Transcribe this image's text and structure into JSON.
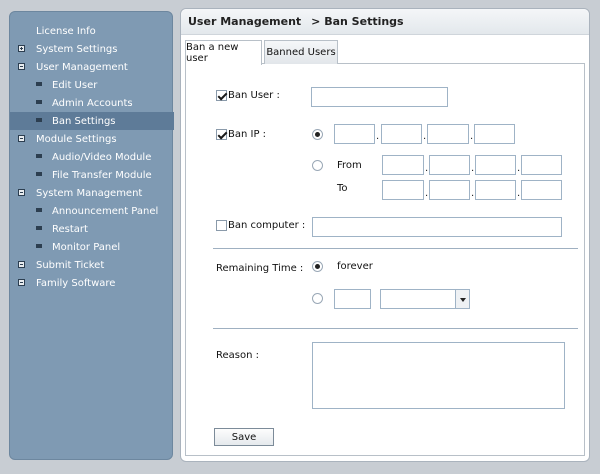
{
  "sidebar": {
    "items": [
      {
        "label": "License Info",
        "level": 0,
        "icon": "none"
      },
      {
        "label": "System Settings",
        "level": 0,
        "icon": "expand-plus-icon"
      },
      {
        "label": "User Management",
        "level": 0,
        "icon": "collapse-minus-icon"
      },
      {
        "label": "Edit User",
        "level": 1,
        "icon": "item-bullet-icon"
      },
      {
        "label": "Admin Accounts",
        "level": 1,
        "icon": "item-bullet-icon"
      },
      {
        "label": "Ban Settings",
        "level": 1,
        "icon": "item-bullet-icon",
        "selected": true
      },
      {
        "label": "Module Settings",
        "level": 0,
        "icon": "collapse-minus-icon"
      },
      {
        "label": "Audio/Video Module",
        "level": 1,
        "icon": "item-bullet-icon"
      },
      {
        "label": "File Transfer Module",
        "level": 1,
        "icon": "item-bullet-icon"
      },
      {
        "label": "System Management",
        "level": 0,
        "icon": "collapse-minus-icon"
      },
      {
        "label": "Announcement Panel",
        "level": 1,
        "icon": "item-bullet-icon"
      },
      {
        "label": "Restart",
        "level": 1,
        "icon": "item-bullet-icon"
      },
      {
        "label": "Monitor Panel",
        "level": 1,
        "icon": "item-bullet-icon"
      },
      {
        "label": "Submit Ticket",
        "level": 0,
        "icon": "collapse-minus-icon"
      },
      {
        "label": "Family Software",
        "level": 0,
        "icon": "collapse-minus-icon"
      }
    ]
  },
  "breadcrumb": {
    "section": "User Management",
    "page": "> Ban Settings"
  },
  "tabs": [
    {
      "label": "Ban a new user",
      "active": true
    },
    {
      "label": "Banned Users",
      "active": false
    }
  ],
  "form": {
    "ban_user_label": "Ban User :",
    "ban_user_checked": true,
    "ban_user_value": "",
    "ban_ip_label": "Ban IP :",
    "ban_ip_checked": true,
    "from_label": "From",
    "to_label": "To",
    "ban_computer_label": "Ban computer :",
    "ban_computer_checked": false,
    "ban_computer_value": "",
    "remaining_time_label": "Remaining Time :",
    "forever_label": "forever",
    "forever_selected": true,
    "duration_value": "",
    "duration_unit_selected": "",
    "reason_label": "Reason :",
    "reason_value": "",
    "save_label": "Save"
  },
  "colors": {
    "sidebar_bg": "#7f9ab3",
    "sidebar_selected": "#5e7b98",
    "input_border": "#9fb3c6"
  }
}
